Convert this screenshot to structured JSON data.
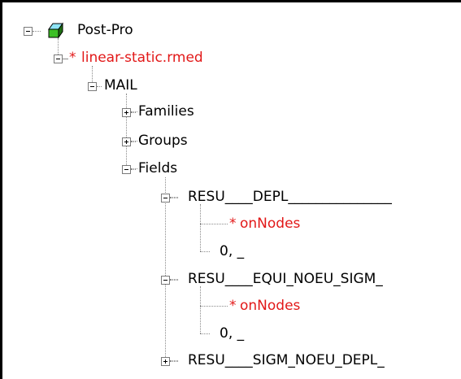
{
  "tree": {
    "root": {
      "label": "Post-Pro",
      "icon": "study-cube-icon",
      "expanded": true
    },
    "file": {
      "marker": "*",
      "label": "linear-static.rmed",
      "expanded": true,
      "color": "#e21818"
    },
    "mesh": {
      "label": "MAIL",
      "expanded": true
    },
    "families": {
      "label": "Families",
      "expanded": false
    },
    "groups": {
      "label": "Groups",
      "expanded": false
    },
    "fields": {
      "label": "Fields",
      "expanded": true
    },
    "field1": {
      "label": "RESU____DEPL_______________",
      "expanded": true,
      "children": [
        {
          "marker": "*",
          "label": "onNodes",
          "color": "#e21818"
        },
        {
          "label": "0, _"
        }
      ]
    },
    "field2": {
      "label": "RESU____EQUI_NOEU_SIGM_",
      "expanded": true,
      "children": [
        {
          "marker": "*",
          "label": "onNodes",
          "color": "#e21818"
        },
        {
          "label": "0, _"
        }
      ]
    },
    "field3": {
      "label": "RESU____SIGM_NOEU_DEPL_",
      "expanded": false
    }
  }
}
